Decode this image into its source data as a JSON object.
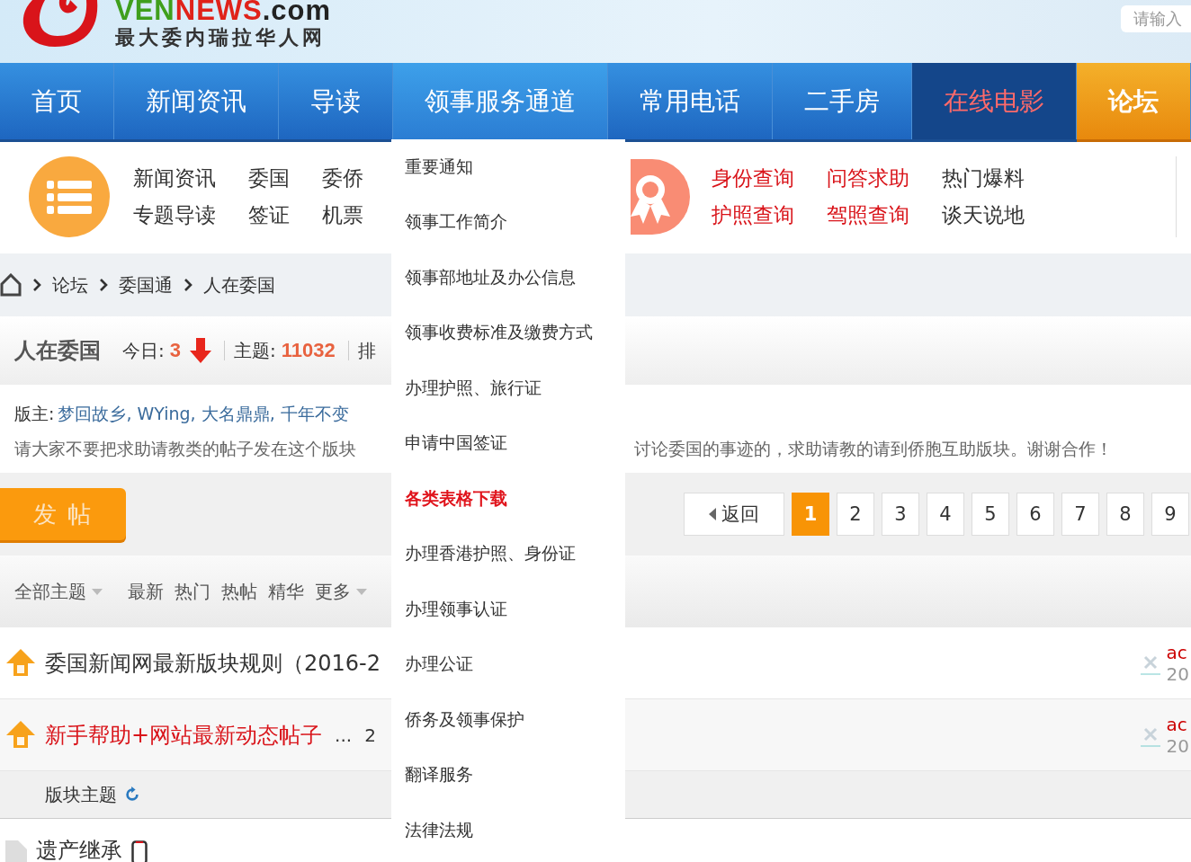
{
  "header": {
    "logo": {
      "wordmark": [
        {
          "text": "VEN",
          "color": "#3f9f1c"
        },
        {
          "text": "NEWS",
          "color": "#e0221a"
        },
        {
          "text": ".com",
          "color": "#222222"
        }
      ],
      "tagline": "最大委内瑞拉华人网"
    },
    "search": {
      "placeholder": "请输入"
    }
  },
  "nav": [
    {
      "label": "首页",
      "kind": "normal",
      "selected": false,
      "expanded": false
    },
    {
      "label": "新闻资讯",
      "kind": "normal",
      "selected": false,
      "expanded": false
    },
    {
      "label": "导读",
      "kind": "normal",
      "selected": false,
      "expanded": false
    },
    {
      "label": "领事服务通道",
      "kind": "normal",
      "selected": false,
      "expanded": true
    },
    {
      "label": "常用电话",
      "kind": "normal",
      "selected": false,
      "expanded": false
    },
    {
      "label": "二手房",
      "kind": "normal",
      "selected": false,
      "expanded": false
    },
    {
      "label": "在线电影",
      "kind": "hot",
      "selected": false,
      "expanded": false
    },
    {
      "label": "论坛",
      "kind": "normal",
      "selected": true,
      "expanded": false
    }
  ],
  "dropdown": [
    {
      "label": "重要通知",
      "highlighted": false
    },
    {
      "label": "领事工作简介",
      "highlighted": false
    },
    {
      "label": "领事部地址及办公信息",
      "highlighted": false
    },
    {
      "label": "领事收费标准及缴费方式",
      "highlighted": false
    },
    {
      "label": "办理护照、旅行证",
      "highlighted": false
    },
    {
      "label": "申请中国签证",
      "highlighted": false
    },
    {
      "label": "各类表格下载",
      "highlighted": true
    },
    {
      "label": "办理香港护照、身份证",
      "highlighted": false
    },
    {
      "label": "办理领事认证",
      "highlighted": false
    },
    {
      "label": "办理公证",
      "highlighted": false
    },
    {
      "label": "侨务及领事保护",
      "highlighted": false
    },
    {
      "label": "翻译服务",
      "highlighted": false
    },
    {
      "label": "法律法规",
      "highlighted": false
    }
  ],
  "quick_links": {
    "left": [
      {
        "label": "新闻资讯",
        "hot": false
      },
      {
        "label": "委国",
        "hot": false
      },
      {
        "label": "委侨",
        "hot": false
      },
      {
        "label": "专题导读",
        "hot": false
      },
      {
        "label": "签证",
        "hot": false
      },
      {
        "label": "机票",
        "hot": false
      }
    ],
    "right": [
      {
        "label": "身份查询",
        "hot": true
      },
      {
        "label": "问答求助",
        "hot": true
      },
      {
        "label": "热门爆料",
        "hot": false
      },
      {
        "label": "护照查询",
        "hot": true
      },
      {
        "label": "驾照查询",
        "hot": true
      },
      {
        "label": "谈天说地",
        "hot": false
      }
    ]
  },
  "breadcrumb": [
    "论坛",
    "委国通",
    "人在委国"
  ],
  "forum": {
    "title": "人在委国",
    "today_label": "今日:",
    "today": "3",
    "falling": true,
    "topics_label": "主题:",
    "topics": "11032",
    "cut_label": "排"
  },
  "moderators": {
    "label": "版主:",
    "names": "梦回故乡, WYing, 大名鼎鼎, 千年不变"
  },
  "notice": [
    "请大家不要把求助请教类的帖子发在这个版块",
    "讨论委国的事迹的，求助请教的请到侨胞互助版块。谢谢合作！"
  ],
  "post_button": "发帖",
  "pager": {
    "back": "返回",
    "pages": [
      {
        "label": "1",
        "selected": true
      },
      {
        "label": "2",
        "selected": false
      },
      {
        "label": "3",
        "selected": false
      },
      {
        "label": "4",
        "selected": false
      },
      {
        "label": "5",
        "selected": false
      },
      {
        "label": "6",
        "selected": false
      },
      {
        "label": "7",
        "selected": false
      },
      {
        "label": "8",
        "selected": false
      },
      {
        "label": "9",
        "selected": false
      }
    ]
  },
  "filters": [
    {
      "label": "全部主题",
      "dropdown": true
    },
    {
      "label": "最新",
      "dropdown": false
    },
    {
      "label": "热门",
      "dropdown": false
    },
    {
      "label": "热帖",
      "dropdown": false
    },
    {
      "label": "精华",
      "dropdown": false
    },
    {
      "label": "更多",
      "dropdown": true
    }
  ],
  "pinned_threads": [
    {
      "title": "委国新闻网最新版块规则（2016-2",
      "hot": false,
      "author": "ac",
      "date": "20"
    },
    {
      "title": "新手帮助+网站最新动态帖子",
      "hot": true,
      "pages": [
        "...",
        "2"
      ],
      "author": "ac",
      "date": "20"
    }
  ],
  "section": {
    "label": "版块主题"
  },
  "threads": [
    {
      "title": "遗产继承"
    }
  ]
}
